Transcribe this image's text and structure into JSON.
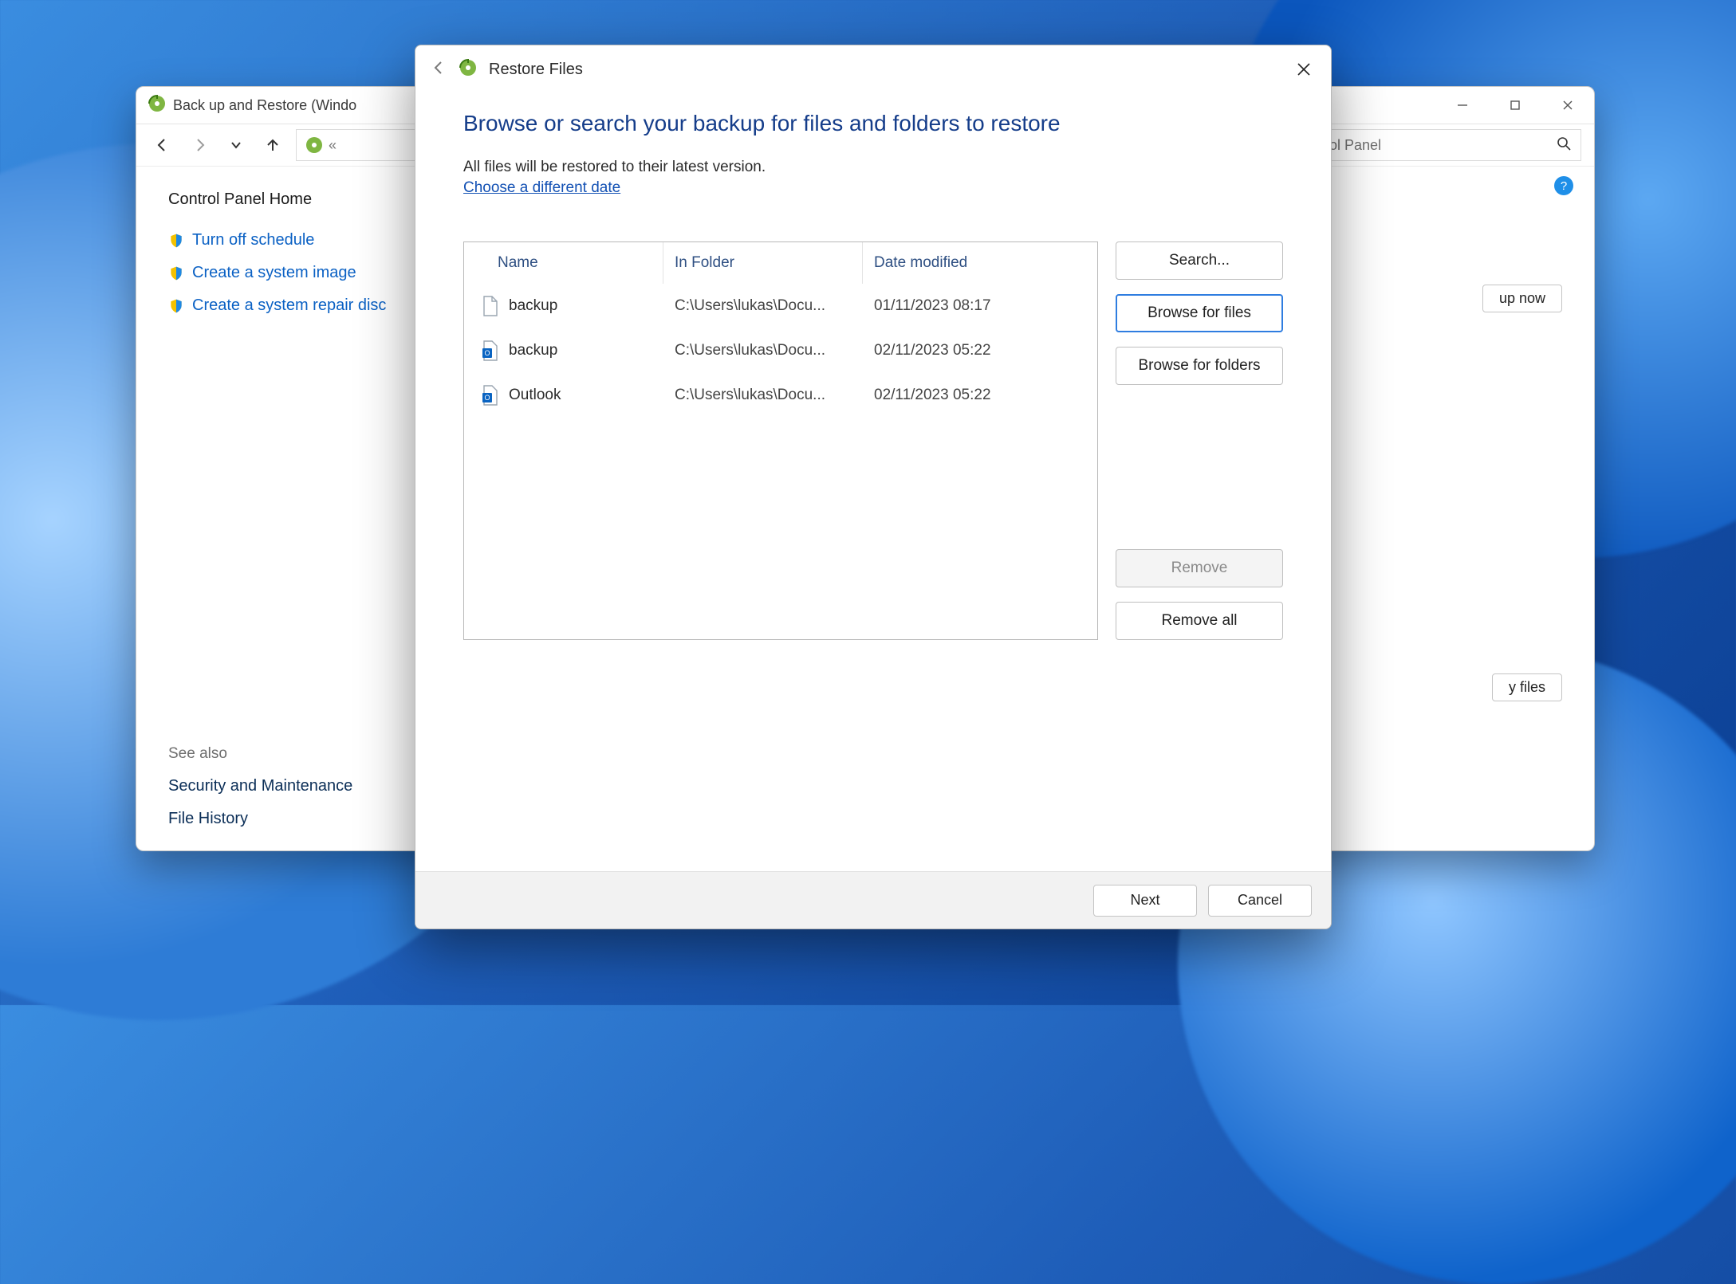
{
  "cp": {
    "title": "Back up and Restore (Windo",
    "address_prefix": "«",
    "search_placeholder": "trol Panel",
    "sidebar": {
      "home": "Control Panel Home",
      "tasks": [
        "Turn off schedule",
        "Create a system image",
        "Create a system repair disc"
      ],
      "see_also_label": "See also",
      "see_also": [
        "Security and Maintenance",
        "File History"
      ]
    },
    "backup_now_btn": "up now",
    "restore_my_btn": "y files"
  },
  "dialog": {
    "title": "Restore Files",
    "heading": "Browse or search your backup for files and folders to restore",
    "subtext": "All files will be restored to their latest version.",
    "link": "Choose a different date",
    "columns": {
      "name": "Name",
      "folder": "In Folder",
      "date": "Date modified"
    },
    "rows": [
      {
        "icon": "file",
        "name": "backup",
        "folder": "C:\\Users\\lukas\\Docu...",
        "date": "01/11/2023 08:17"
      },
      {
        "icon": "outlook",
        "name": "backup",
        "folder": "C:\\Users\\lukas\\Docu...",
        "date": "02/11/2023 05:22"
      },
      {
        "icon": "outlook",
        "name": "Outlook",
        "folder": "C:\\Users\\lukas\\Docu...",
        "date": "02/11/2023 05:22"
      }
    ],
    "buttons": {
      "search": "Search...",
      "browse_files": "Browse for files",
      "browse_folders": "Browse for folders",
      "remove": "Remove",
      "remove_all": "Remove all",
      "next": "Next",
      "cancel": "Cancel"
    }
  }
}
